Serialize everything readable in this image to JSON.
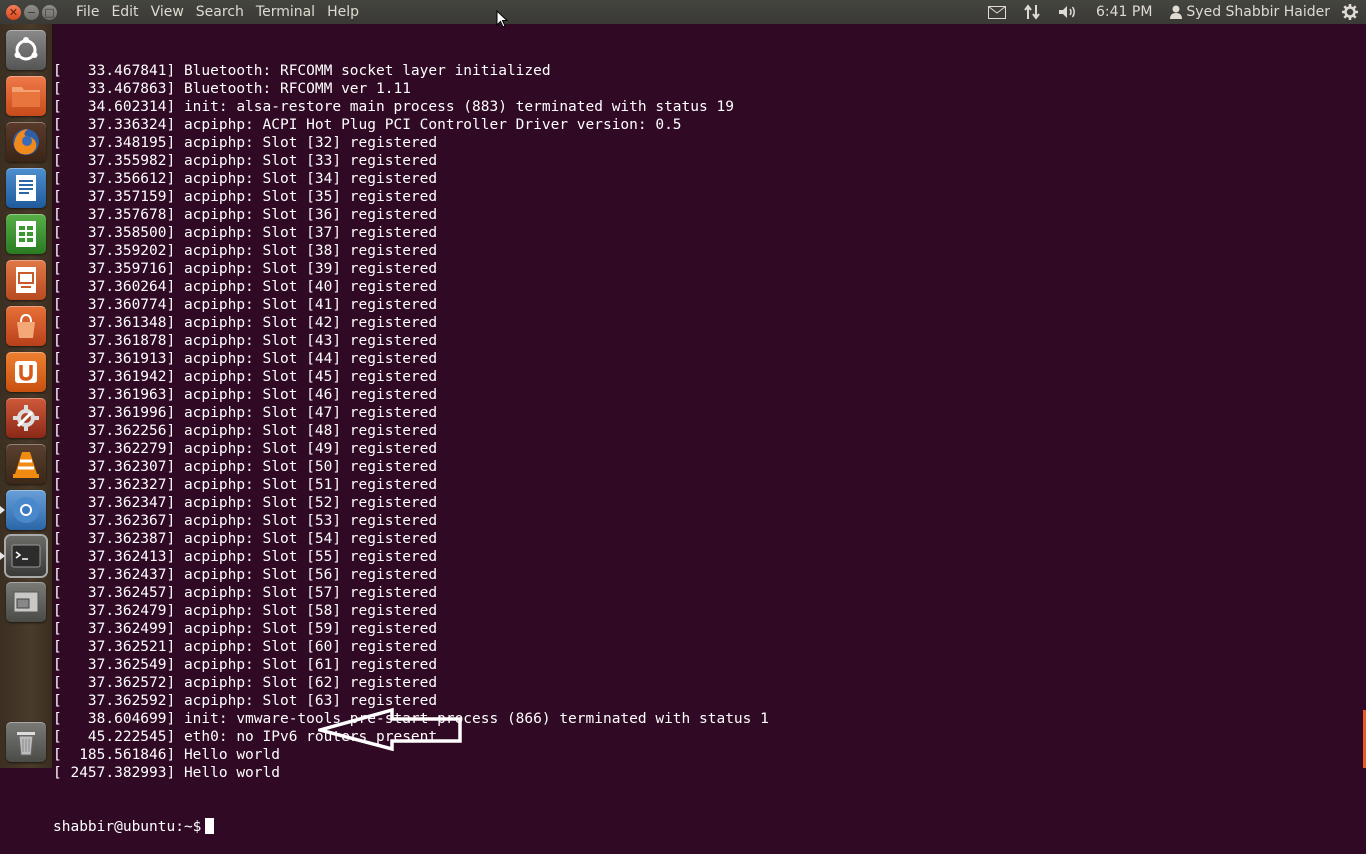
{
  "window": {
    "menus": [
      "File",
      "Edit",
      "View",
      "Search",
      "Terminal",
      "Help"
    ],
    "clock": "6:41 PM",
    "user": "Syed Shabbir Haider"
  },
  "launcher": {
    "icons": [
      "dash-home-icon",
      "files-icon",
      "firefox-icon",
      "writer-icon",
      "calc-icon",
      "impress-icon",
      "software-center-icon",
      "ubuntu-one-icon",
      "system-settings-icon",
      "vlc-icon",
      "chromium-icon",
      "terminal-icon",
      "workspaces-icon",
      "trash-icon"
    ]
  },
  "terminal": {
    "lines": [
      "[   33.467841] Bluetooth: RFCOMM socket layer initialized",
      "[   33.467863] Bluetooth: RFCOMM ver 1.11",
      "[   34.602314] init: alsa-restore main process (883) terminated with status 19",
      "[   37.336324] acpiphp: ACPI Hot Plug PCI Controller Driver version: 0.5",
      "[   37.348195] acpiphp: Slot [32] registered",
      "[   37.355982] acpiphp: Slot [33] registered",
      "[   37.356612] acpiphp: Slot [34] registered",
      "[   37.357159] acpiphp: Slot [35] registered",
      "[   37.357678] acpiphp: Slot [36] registered",
      "[   37.358500] acpiphp: Slot [37] registered",
      "[   37.359202] acpiphp: Slot [38] registered",
      "[   37.359716] acpiphp: Slot [39] registered",
      "[   37.360264] acpiphp: Slot [40] registered",
      "[   37.360774] acpiphp: Slot [41] registered",
      "[   37.361348] acpiphp: Slot [42] registered",
      "[   37.361878] acpiphp: Slot [43] registered",
      "[   37.361913] acpiphp: Slot [44] registered",
      "[   37.361942] acpiphp: Slot [45] registered",
      "[   37.361963] acpiphp: Slot [46] registered",
      "[   37.361996] acpiphp: Slot [47] registered",
      "[   37.362256] acpiphp: Slot [48] registered",
      "[   37.362279] acpiphp: Slot [49] registered",
      "[   37.362307] acpiphp: Slot [50] registered",
      "[   37.362327] acpiphp: Slot [51] registered",
      "[   37.362347] acpiphp: Slot [52] registered",
      "[   37.362367] acpiphp: Slot [53] registered",
      "[   37.362387] acpiphp: Slot [54] registered",
      "[   37.362413] acpiphp: Slot [55] registered",
      "[   37.362437] acpiphp: Slot [56] registered",
      "[   37.362457] acpiphp: Slot [57] registered",
      "[   37.362479] acpiphp: Slot [58] registered",
      "[   37.362499] acpiphp: Slot [59] registered",
      "[   37.362521] acpiphp: Slot [60] registered",
      "[   37.362549] acpiphp: Slot [61] registered",
      "[   37.362572] acpiphp: Slot [62] registered",
      "[   37.362592] acpiphp: Slot [63] registered",
      "[   38.604699] init: vmware-tools pre-start process (866) terminated with status 1",
      "[   45.222545] eth0: no IPv6 routers present",
      "[  185.561846] Hello world",
      "[ 2457.382993] Hello world"
    ],
    "prompt": "shabbir@ubuntu:~$"
  }
}
